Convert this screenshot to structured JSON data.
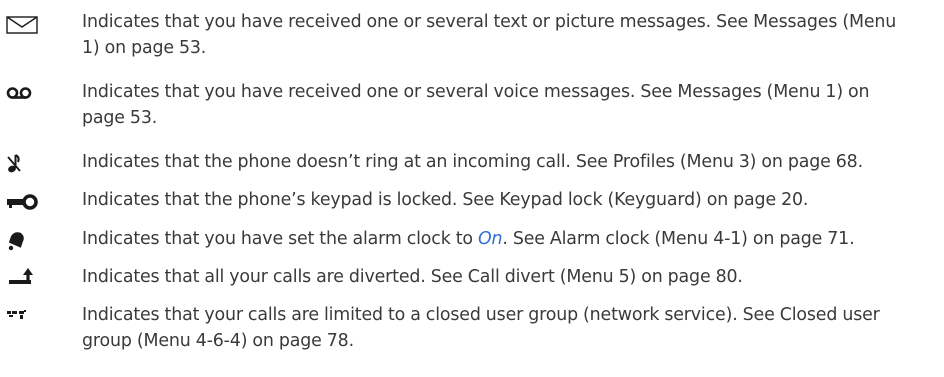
{
  "colors": {
    "text": "#3a3a3a",
    "accent": "#2e6fcf",
    "icon": "#1a1a1a"
  },
  "indicators": [
    {
      "icon": "envelope-icon",
      "line1": "Indicates that you have received one or several text or picture messages. See Messages (Menu",
      "line2": "1) on page 53."
    },
    {
      "icon": "voicemail-icon",
      "line1": "Indicates that you have received one or several voice messages. See Messages (Menu 1) on",
      "line2": "page 53."
    },
    {
      "icon": "silent-icon",
      "line1": "Indicates that the phone doesn’t ring at an incoming call. See Profiles (Menu 3) on page 68."
    },
    {
      "icon": "key-lock-icon",
      "line1": "Indicates that the phone’s keypad is locked. See Keypad lock (Keyguard) on page 20."
    },
    {
      "icon": "alarm-bell-icon",
      "before": "Indicates that you have set the alarm clock to ",
      "highlight": "On",
      "after": ". See Alarm clock (Menu 4-1) on page 71."
    },
    {
      "icon": "call-divert-icon",
      "line1": "Indicates that all your calls are diverted. See Call divert (Menu 5) on page 80."
    },
    {
      "icon": "closed-user-group-icon",
      "line1": "Indicates that your calls are limited to a closed user group (network service). See Closed user",
      "line2": "group (Menu 4-6-4) on page 78."
    }
  ]
}
